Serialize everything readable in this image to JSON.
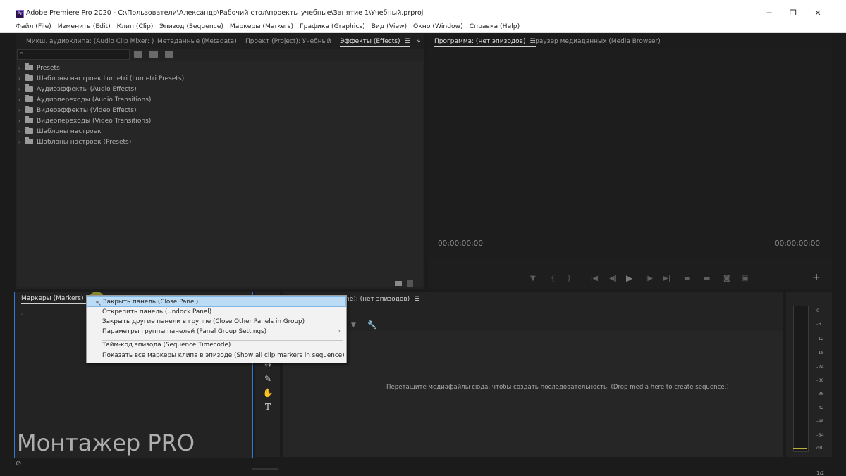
{
  "window": {
    "title": "Adobe Premiere Pro 2020 - C:\\Пользователи\\Александр\\Рабочий стол\\проекты учебные\\Занятие 1\\Учебный.prproj",
    "app_icon_text": "Pr",
    "minimize": "─",
    "restore": "❐",
    "close": "✕"
  },
  "menu": [
    "Файл (File)",
    "Изменить (Edit)",
    "Клип (Clip)",
    "Эпизод (Sequence)",
    "Маркеры (Markers)",
    "Графика (Graphics)",
    "Вид (View)",
    "Окно (Window)",
    "Справка (Help)"
  ],
  "left_panel": {
    "tabs": [
      "Микш. аудиоклипа: (Audio Clip Mixer: )",
      "Метаданные (Metadata)",
      "Проект (Project): Учебный",
      "Эффекты (Effects)"
    ],
    "overflow": "»",
    "tree": [
      "Presets",
      "Шаблоны настроек Lumetri (Lumetri Presets)",
      "Аудиоэффекты (Audio Effects)",
      "Аудиопереходы (Audio Transitions)",
      "Видеоэффекты (Video Effects)",
      "Видеопереходы (Video Transitions)",
      "Шаблоны настроек",
      "Шаблоны настроек (Presets)"
    ]
  },
  "program_panel": {
    "tabs": [
      "Программа: (нет эпизодов)",
      "Браузер медиаданных (Media Browser)"
    ],
    "timecode_left": "00;00;00;00",
    "timecode_right": "00;00;00;00",
    "add": "+"
  },
  "markers_panel": {
    "tab": "Маркеры (Markers)"
  },
  "context_menu": {
    "items": [
      "Закрыть панель (Close Panel)",
      "Открепить панель (Undock Panel)",
      "Закрыть другие панели в группе (Close Other Panels in Group)",
      "Параметры группы панелей (Panel Group Settings)",
      "Тайм-код эпизода (Sequence Timecode)",
      "Показать все маркеры клипа в эпизоде (Show all clip markers in sequence)"
    ],
    "submenu_arrow": "›"
  },
  "timeline_panel": {
    "tab_partial": "ne): (нет эпизодов)",
    "drop_hint": "Перетащите медиафайлы сюда, чтобы создать последовательность. (Drop media here to create sequence.)"
  },
  "audio_meter": {
    "labels": [
      "0",
      "-6",
      "-12",
      "-18",
      "-24",
      "-30",
      "-36",
      "-42",
      "-48",
      "-54",
      "dB"
    ]
  },
  "watermark": "Монтажер PRO",
  "status": {
    "page": "1/2"
  },
  "colors": {
    "highlight": "#bcdcf5",
    "accent_blue": "#2d8ceb"
  }
}
